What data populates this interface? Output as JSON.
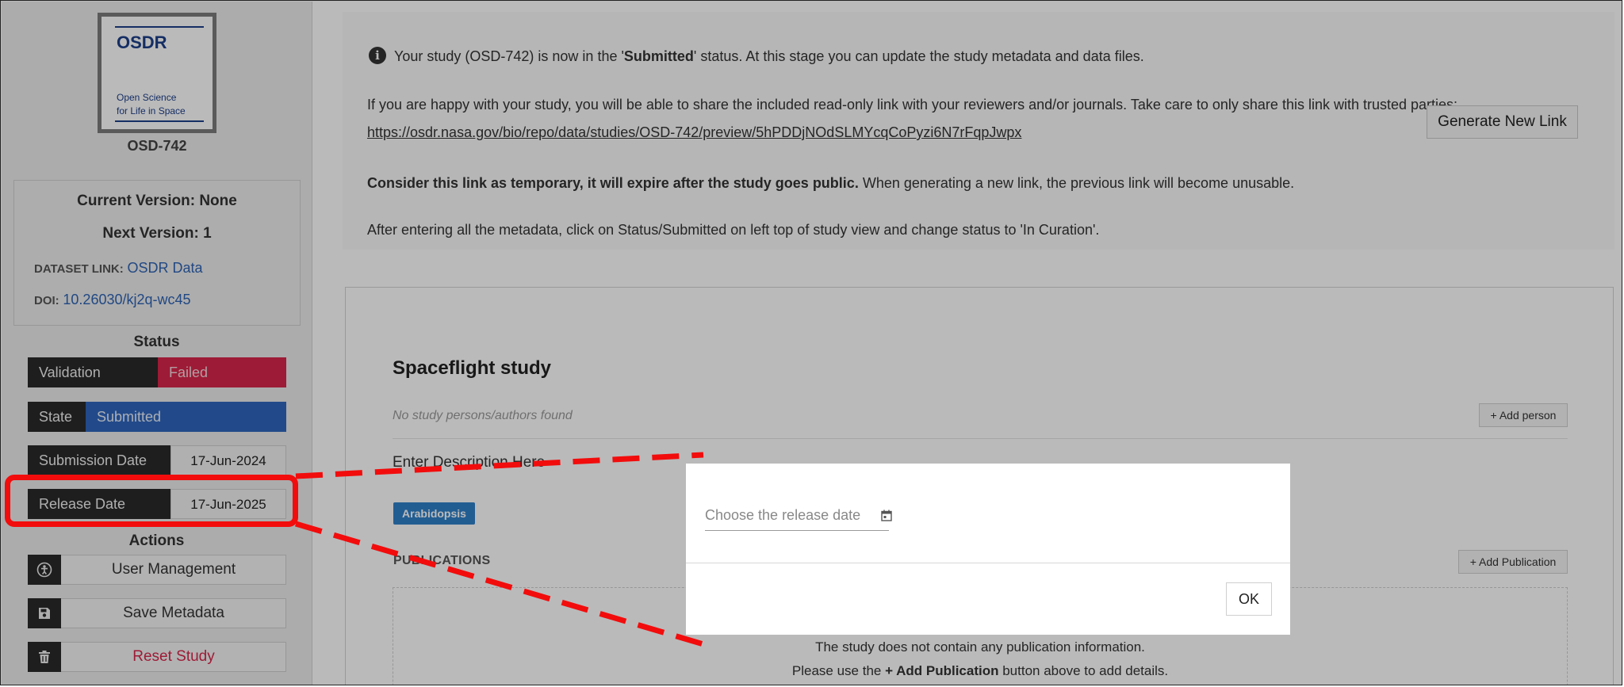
{
  "sidebar": {
    "logo": {
      "title": "OSDR",
      "subtitle_line1": "Open Science",
      "subtitle_line2": "for Life in Space"
    },
    "study_id": "OSD-742",
    "current_version": "Current Version: None",
    "next_version": "Next Version: 1",
    "dataset_link_label": "DATASET LINK:",
    "dataset_link_text": "OSDR Data",
    "doi_label": "DOI:",
    "doi_value": "10.26030/kj2q-wc45",
    "status_title": "Status",
    "status_rows": [
      {
        "label": "Validation",
        "value": "Failed"
      },
      {
        "label": "State",
        "value": "Submitted"
      },
      {
        "label": "Submission Date",
        "value": "17-Jun-2024"
      },
      {
        "label": "Release Date",
        "value": "17-Jun-2025"
      }
    ],
    "actions_title": "Actions",
    "actions": [
      {
        "label": "User Management",
        "icon": "user-management-icon"
      },
      {
        "label": "Save Metadata",
        "icon": "save-icon"
      },
      {
        "label": "Reset Study",
        "icon": "trash-icon"
      }
    ]
  },
  "info": {
    "line1_pre": "Your study (OSD-742) is now in the '",
    "line1_bold": "Submitted",
    "line1_post": "' status. At this stage you can update the study metadata and data files.",
    "line2": "If you are happy with your study, you will be able to share the included read-only link with your reviewers and/or journals. Take care to only share this link with trusted parties:",
    "preview_link": "https://osdr.nasa.gov/bio/repo/data/studies/OSD-742/preview/5hPDDjNOdSLMYcqCoPyzi6N7rFqpJwpx",
    "generate_button": "Generate New Link",
    "line3_bold": "Consider this link as temporary, it will expire after the study goes public.",
    "line3_rest": " When generating a new link, the previous link will become unusable.",
    "line4": "After entering all the metadata, click on Status/Submitted on left top of study view and change status to 'In Curation'."
  },
  "study": {
    "title": "Spaceflight study",
    "no_persons": "No study persons/authors found",
    "add_person": "+ Add person",
    "description": "Enter Description Here",
    "tag": "Arabidopsis",
    "publications_label": "PUBLICATIONS",
    "add_publication": "+ Add Publication",
    "pub_empty_line1": "The study does not contain any publication information.",
    "pub_empty_line2_pre": "Please use the ",
    "pub_empty_line2_bold": "+ Add Publication",
    "pub_empty_line2_post": " button above to add details."
  },
  "dialog": {
    "release_placeholder": "Choose the release date",
    "ok_button": "OK"
  },
  "colors": {
    "failed": "#d8254a",
    "submitted": "#2f66bd",
    "annotation": "#f20c0c",
    "logo_blue": "#1e3f8a",
    "link_blue": "#2e63b4"
  }
}
